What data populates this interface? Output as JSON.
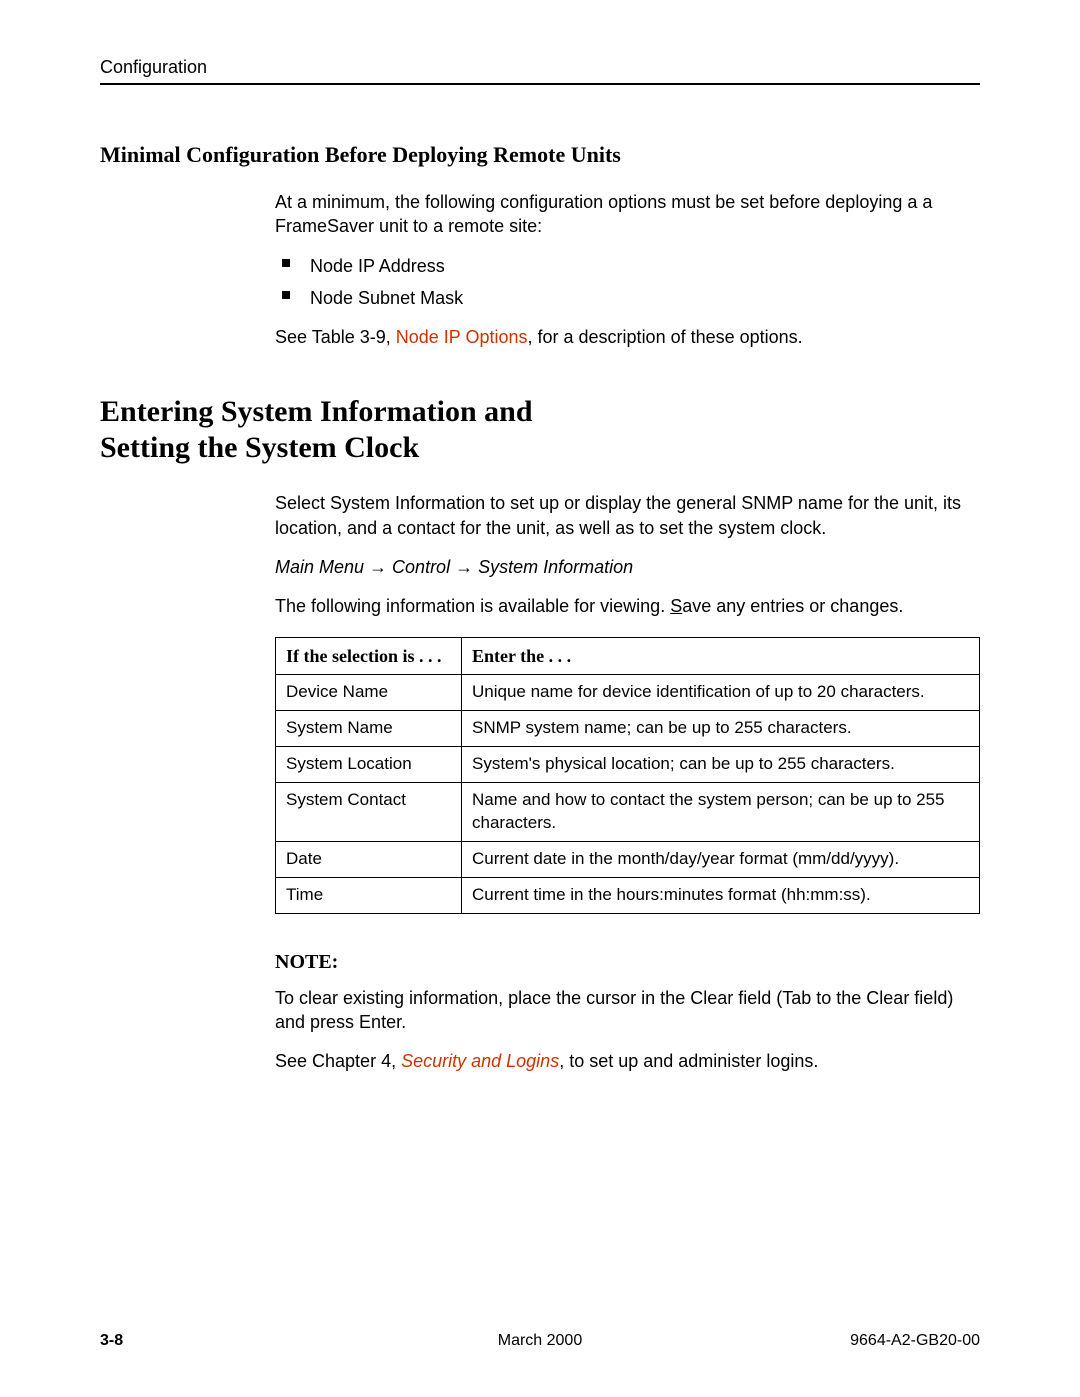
{
  "header": {
    "section": "Configuration"
  },
  "s1": {
    "title": "Minimal Configuration Before Deploying Remote Units",
    "intro": "At a minimum, the following configuration options must be set before deploying a a FrameSaver unit to a remote site:",
    "bullets": [
      "Node IP Address",
      "Node Subnet Mask"
    ],
    "see_pre": "See Table 3-9, ",
    "see_link": "Node IP Options",
    "see_post": ", for a description of these options."
  },
  "s2": {
    "title_l1": "Entering System Information and",
    "title_l2": "Setting the System Clock",
    "p1": "Select System Information to set up or display the general SNMP name for the unit, its location, and a contact for the unit, as well as to set the system clock.",
    "nav": "Main Menu → Control → System Information",
    "p2_pre": "The following information is available for viewing. ",
    "p2_s": "S",
    "p2_post": "ave any entries or changes.",
    "table": {
      "h1": "If the selection is . . .",
      "h2": "Enter the . . .",
      "rows": [
        {
          "a": "Device Name",
          "b": "Unique name for device identification of up to 20 characters."
        },
        {
          "a": "System Name",
          "b": "SNMP system name; can be up to 255 characters."
        },
        {
          "a": "System Location",
          "b": "System's physical location; can be up to 255 characters."
        },
        {
          "a": "System Contact",
          "b": "Name and how to contact the system person; can be up to 255 characters."
        },
        {
          "a": "Date",
          "b": "Current date in the month/day/year format (mm/dd/yyyy)."
        },
        {
          "a": "Time",
          "b": "Current time in the hours:minutes format (hh:mm:ss)."
        }
      ]
    },
    "note_title": "NOTE:",
    "note_body": "To clear existing information, place the cursor in the Clear field (Tab to the Clear field) and press Enter.",
    "see2_pre": "See Chapter 4, ",
    "see2_link": "Security and Logins",
    "see2_post": ", to set up and administer logins."
  },
  "footer": {
    "page": "3-8",
    "date": "March 2000",
    "doc": "9664-A2-GB20-00"
  }
}
